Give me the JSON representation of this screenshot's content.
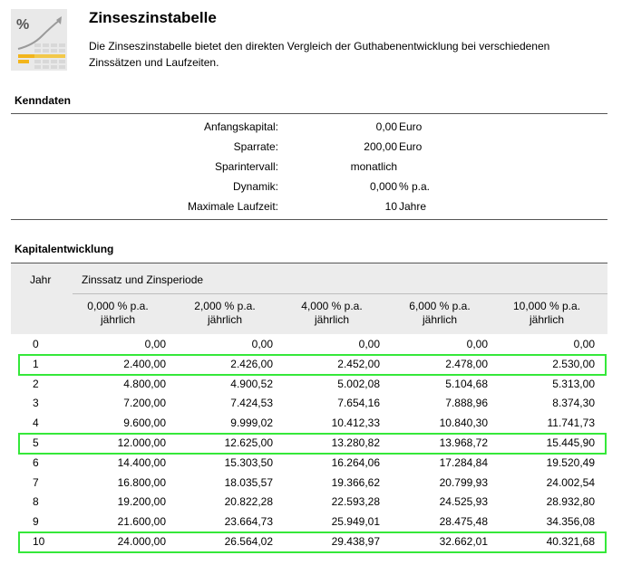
{
  "header": {
    "title": "Zinseszinstabelle",
    "intro": "Die Zinseszinstabelle bietet den direkten Vergleich der Guthabenentwicklung bei verschiedenen Zinssätzen und Laufzeiten.",
    "logo_icon": "percent-growth-chart-icon"
  },
  "kenndaten": {
    "title": "Kenndaten",
    "rows": [
      {
        "label": "Anfangskapital:",
        "value": "0,00",
        "unit": "Euro"
      },
      {
        "label": "Sparrate:",
        "value": "200,00",
        "unit": "Euro"
      },
      {
        "label": "Sparintervall:",
        "value": "monatlich",
        "unit": ""
      },
      {
        "label": "Dynamik:",
        "value": "0,000",
        "unit": "% p.a."
      },
      {
        "label": "Maximale Laufzeit:",
        "value": "10",
        "unit": "Jahre"
      }
    ]
  },
  "kapital": {
    "title": "Kapitalentwicklung",
    "col_jahr": "Jahr",
    "col_group": "Zinssatz und Zinsperiode",
    "columns": [
      {
        "rate": "0,000 % p.a.",
        "period": "jährlich"
      },
      {
        "rate": "2,000 % p.a.",
        "period": "jährlich"
      },
      {
        "rate": "4,000 % p.a.",
        "period": "jährlich"
      },
      {
        "rate": "6,000 % p.a.",
        "period": "jährlich"
      },
      {
        "rate": "10,000 % p.a.",
        "period": "jährlich"
      }
    ],
    "rows": [
      {
        "year": "0",
        "values": [
          "0,00",
          "0,00",
          "0,00",
          "0,00",
          "0,00"
        ]
      },
      {
        "year": "1",
        "values": [
          "2.400,00",
          "2.426,00",
          "2.452,00",
          "2.478,00",
          "2.530,00"
        ]
      },
      {
        "year": "2",
        "values": [
          "4.800,00",
          "4.900,52",
          "5.002,08",
          "5.104,68",
          "5.313,00"
        ]
      },
      {
        "year": "3",
        "values": [
          "7.200,00",
          "7.424,53",
          "7.654,16",
          "7.888,96",
          "8.374,30"
        ]
      },
      {
        "year": "4",
        "values": [
          "9.600,00",
          "9.999,02",
          "10.412,33",
          "10.840,30",
          "11.741,73"
        ]
      },
      {
        "year": "5",
        "values": [
          "12.000,00",
          "12.625,00",
          "13.280,82",
          "13.968,72",
          "15.445,90"
        ]
      },
      {
        "year": "6",
        "values": [
          "14.400,00",
          "15.303,50",
          "16.264,06",
          "17.284,84",
          "19.520,49"
        ]
      },
      {
        "year": "7",
        "values": [
          "16.800,00",
          "18.035,57",
          "19.366,62",
          "20.799,93",
          "24.002,54"
        ]
      },
      {
        "year": "8",
        "values": [
          "19.200,00",
          "20.822,28",
          "22.593,28",
          "24.525,93",
          "28.932,80"
        ]
      },
      {
        "year": "9",
        "values": [
          "21.600,00",
          "23.664,73",
          "25.949,01",
          "28.475,48",
          "34.356,08"
        ]
      },
      {
        "year": "10",
        "values": [
          "24.000,00",
          "26.564,02",
          "29.438,97",
          "32.662,01",
          "40.321,68"
        ]
      }
    ],
    "highlighted_years": [
      "1",
      "5",
      "10"
    ],
    "highlight_color": "#35e83a"
  }
}
